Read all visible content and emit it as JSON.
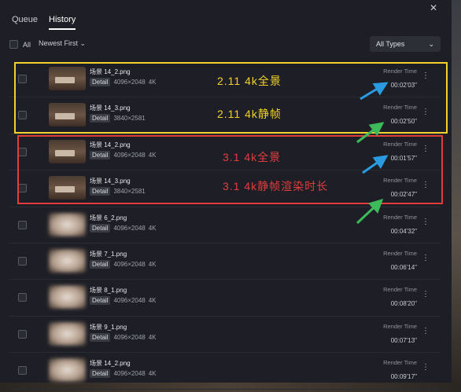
{
  "tabs": [
    {
      "label": "Queue",
      "active": false
    },
    {
      "label": "History",
      "active": true
    }
  ],
  "toolbar": {
    "select_all_label": "All",
    "sort_label": "Newest First",
    "type_filter_label": "All Types"
  },
  "rows": [
    {
      "name": "场景 14_2.png",
      "detail": "Detail",
      "resolution": "4096×2048",
      "quality": "4K",
      "render_time_label": "Render Time",
      "render_time": "00:02'03\"",
      "thumb": "room"
    },
    {
      "name": "场景 14_3.png",
      "detail": "Detail",
      "resolution": "3840×2581",
      "quality": "",
      "render_time_label": "Render Time",
      "render_time": "00:02'50\"",
      "thumb": "room"
    },
    {
      "name": "场景 14_2.png",
      "detail": "Detail",
      "resolution": "4096×2048",
      "quality": "4K",
      "render_time_label": "Render Time",
      "render_time": "00:01'57\"",
      "thumb": "room"
    },
    {
      "name": "场景 14_3.png",
      "detail": "Detail",
      "resolution": "3840×2581",
      "quality": "",
      "render_time_label": "Render Time",
      "render_time": "00:02'47\"",
      "thumb": "room"
    },
    {
      "name": "场景 6_2.png",
      "detail": "Detail",
      "resolution": "4096×2048",
      "quality": "4K",
      "render_time_label": "Render Time",
      "render_time": "00:04'32\"",
      "thumb": "blur"
    },
    {
      "name": "场景 7_1.png",
      "detail": "Detail",
      "resolution": "4096×2048",
      "quality": "4K",
      "render_time_label": "Render Time",
      "render_time": "00:06'14\"",
      "thumb": "blur"
    },
    {
      "name": "场景 8_1.png",
      "detail": "Detail",
      "resolution": "4096×2048",
      "quality": "4K",
      "render_time_label": "Render Time",
      "render_time": "00:08'20\"",
      "thumb": "blur"
    },
    {
      "name": "场景 9_1.png",
      "detail": "Detail",
      "resolution": "4096×2048",
      "quality": "4K",
      "render_time_label": "Render Time",
      "render_time": "00:07'13\"",
      "thumb": "blur"
    },
    {
      "name": "场景 14_2.png",
      "detail": "Detail",
      "resolution": "4096×2048",
      "quality": "4K",
      "render_time_label": "Render Time",
      "render_time": "00:09'17\"",
      "thumb": "blur"
    }
  ],
  "annotations": {
    "yellow_1": "2.11 4k全景",
    "yellow_2": "2.11 4k静帧",
    "red_1": "3.1 4k全景",
    "red_2": "3.1 4k静帧渲染时长"
  },
  "colors": {
    "panel_bg": "#1e1f26",
    "highlight_yellow": "#f2d12c",
    "highlight_red": "#e23d3d",
    "arrow_blue": "#2a9be0",
    "arrow_green": "#3dbb5a"
  },
  "icons": {
    "close": "close-icon",
    "more": "more-vertical-icon",
    "chevron": "chevron-down-icon"
  }
}
